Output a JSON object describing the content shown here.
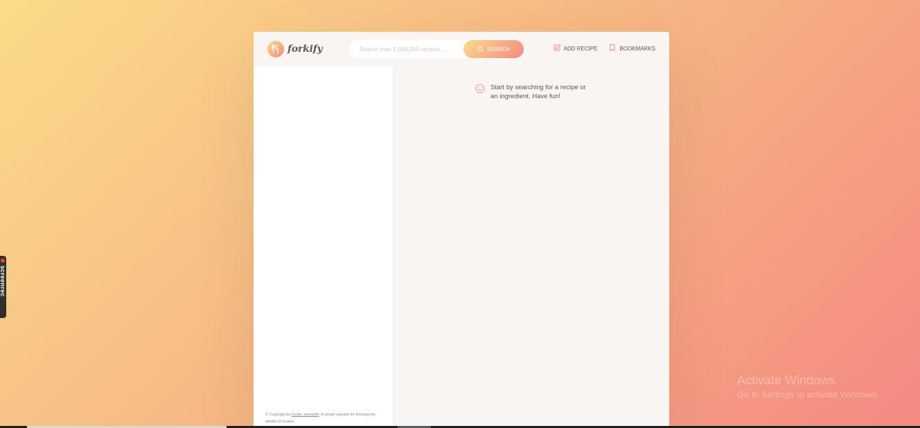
{
  "header": {
    "logo_text": "forkify",
    "search_placeholder": "Search over 1,000,000 recipes...",
    "search_button_label": "Search",
    "nav": {
      "add_recipe_label": "Add recipe",
      "bookmarks_label": "Bookmarks"
    }
  },
  "recipe_panel": {
    "message": "Start by searching for a recipe or an ingredient. Have fun!"
  },
  "footer": {
    "copyright_prefix": "© Copyright by ",
    "copyright_author": "Kedar Jaswanth",
    "copyright_suffix": ". A simple website for fetching the details of recipes"
  },
  "side_widget": {
    "label": "screenrec"
  },
  "watermark": {
    "title": "Activate Windows",
    "subtitle": "Go to Settings to activate Windows."
  },
  "colors": {
    "accent_start": "#fbdb89",
    "accent_end": "#f48982",
    "text": "#615551",
    "panel_bg": "#f9f5f3"
  }
}
